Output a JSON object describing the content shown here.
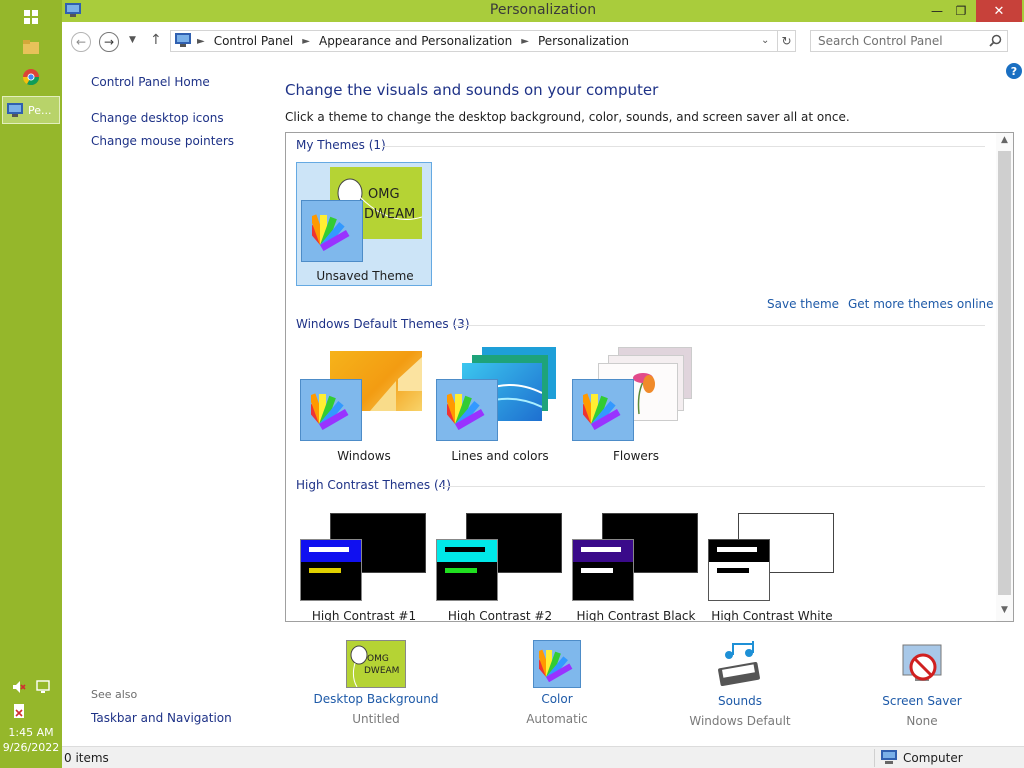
{
  "window": {
    "title": "Personalization",
    "minimize": "—",
    "restore": "❐",
    "close": "✕"
  },
  "taskbar": {
    "active_label": "Pe...",
    "time": "1:45 AM",
    "date": "9/26/2022"
  },
  "nav": {
    "breadcrumb": [
      "Control Panel",
      "Appearance and Personalization",
      "Personalization"
    ],
    "search_placeholder": "Search Control Panel"
  },
  "left": {
    "home": "Control Panel Home",
    "links": [
      "Change desktop icons",
      "Change mouse pointers"
    ],
    "see_also": "See also",
    "see_also_link": "Taskbar and Navigation"
  },
  "main": {
    "heading": "Change the visuals and sounds on your computer",
    "subheading": "Click a theme to change the desktop background, color, sounds, and screen saver all at once."
  },
  "themes": {
    "my_header": "My Themes (1)",
    "my": [
      {
        "name": "Unsaved Theme",
        "bg_text_1": "OMG",
        "bg_text_2": "DWEAM"
      }
    ],
    "save_link": "Save theme",
    "more_link": "Get more themes online",
    "default_header": "Windows Default Themes (3)",
    "default": [
      {
        "name": "Windows"
      },
      {
        "name": "Lines and colors"
      },
      {
        "name": "Flowers"
      }
    ],
    "hc_header": "High Contrast Themes (4)",
    "hc": [
      {
        "name": "High Contrast #1"
      },
      {
        "name": "High Contrast #2"
      },
      {
        "name": "High Contrast Black"
      },
      {
        "name": "High Contrast White"
      }
    ]
  },
  "tiles": [
    {
      "label": "Desktop Background",
      "sub": "Untitled",
      "icon": "desktop-background-icon"
    },
    {
      "label": "Color",
      "sub": "Automatic",
      "icon": "color-palette-icon"
    },
    {
      "label": "Sounds",
      "sub": "Windows Default",
      "icon": "sounds-icon"
    },
    {
      "label": "Screen Saver",
      "sub": "None",
      "icon": "screen-saver-icon"
    }
  ],
  "status": {
    "items": "0 items",
    "location": "Computer"
  },
  "colors": {
    "accent_green": "#a9cc3c",
    "link_blue": "#1e3287",
    "close_red": "#c7413a"
  }
}
